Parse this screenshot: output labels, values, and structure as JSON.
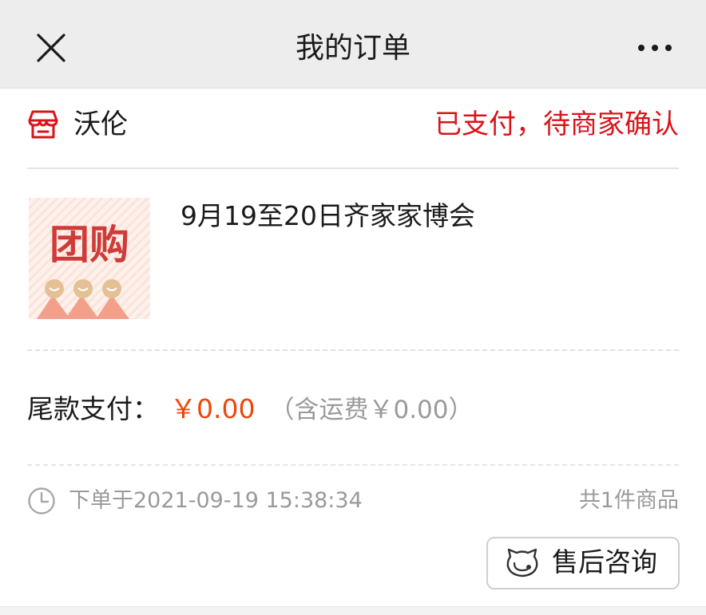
{
  "header": {
    "title": "我的订单",
    "close_icon": "close-icon",
    "more_icon": "more-icon"
  },
  "shop": {
    "name": "沃伦",
    "icon": "shop-icon",
    "status": "已支付，待商家确认",
    "status_color": "#d8141a"
  },
  "product": {
    "thumbnail_text": "团购",
    "title": "9月19至20日齐家家博会"
  },
  "payment": {
    "label": "尾款支付：",
    "amount": "￥0.00",
    "amount_color": "#f0450a",
    "shipping_note": "（含运费￥0.00）"
  },
  "order": {
    "clock_icon": "clock-icon",
    "time_text": "下单于2021-09-19 15:38:34",
    "item_count": "共1件商品"
  },
  "actions": {
    "after_sale_label": "售后咨询",
    "after_sale_icon": "customer-service-icon"
  }
}
